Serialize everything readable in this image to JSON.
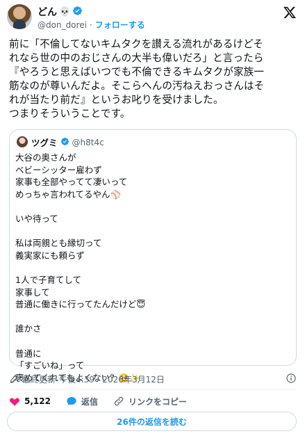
{
  "author": {
    "display_name": "どん",
    "name_emoji": "💀",
    "handle": "@don_dorei",
    "separator": "·",
    "follow_label": "フォローする"
  },
  "tweet": {
    "text": "前に「不倫してないキムタクを讃える流れがあるけどそ\nれなら世の中のおじさんの大半も偉いだろ」と言ったら\n『やろうと思えばいつでも不倫できるキムタクが家族一\n筋なのが尊いんだよ。そこらへんの汚ねえおっさんはそ\nれが当たり前だ』というお叱りを受けました。\nつまりそういうことです。"
  },
  "quote": {
    "display_name": "ツグミ",
    "handle": "@h8t4c",
    "text": "大谷の奥さんが\nベビーシッター雇わず\n家事も全部やってて凄いって\nめっちゃ言われてるやん⚾\n\nいや待って\n\n私は両親とも縁切って\n義実家にも頼らず\n\n1人で子育てして\n家事して\n普通に働きに行ってたんだけど😇\n\n誰かさ\n\n普通に\n「すごいね」って\n褒めてくれてもよくない？🥺✨"
  },
  "meta": {
    "label": "最終更新",
    "timestamp": "午後4:39 · 2026年3月12日"
  },
  "actions": {
    "likes": "5,122",
    "reply_label": "返信",
    "copy_link_label": "リンクをコピー"
  },
  "read_replies_label": "26件の返信を読む",
  "colors": {
    "accent": "#1d9bf0",
    "like": "#f91880",
    "text": "#0f1419",
    "secondary": "#536471",
    "border": "#cfd9de"
  },
  "icons": [
    "verified-badge-icon",
    "x-logo-icon",
    "edit-history-icon",
    "info-icon",
    "heart-icon",
    "reply-icon",
    "link-icon"
  ]
}
